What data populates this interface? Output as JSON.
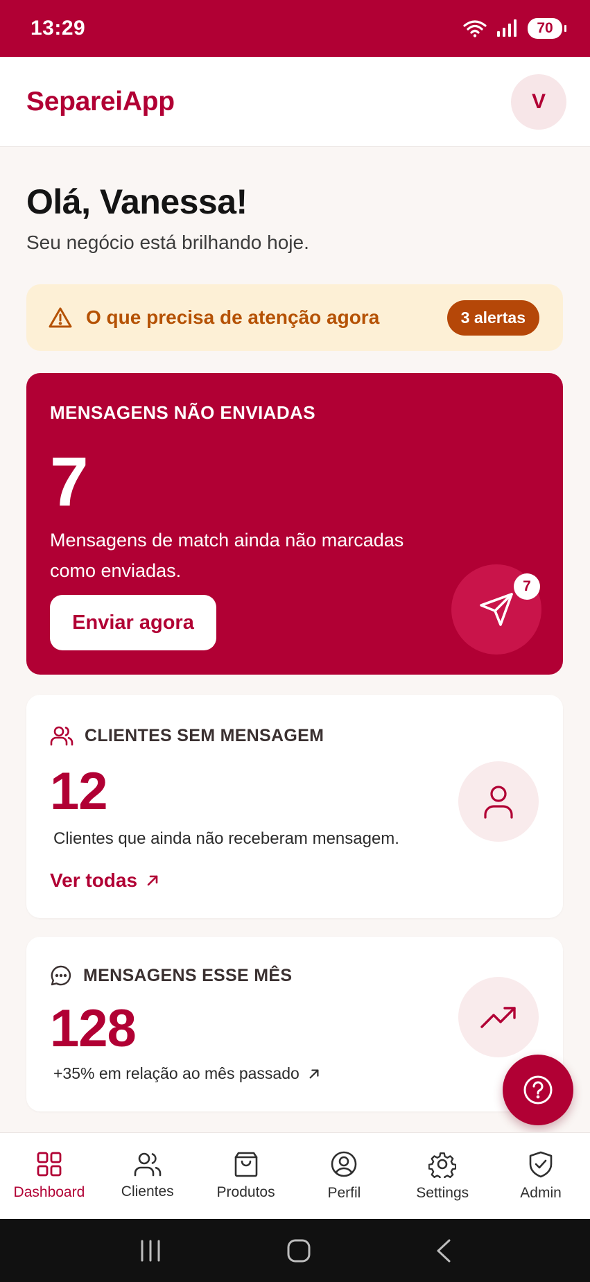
{
  "status_bar": {
    "time": "13:29",
    "battery": "70"
  },
  "header": {
    "brand": "SepareiApp",
    "avatar_initial": "V"
  },
  "greeting": {
    "title": "Olá, Vanessa!",
    "subtitle": "Seu negócio está brilhando hoje."
  },
  "alert": {
    "text": "O que precisa de atenção agora",
    "count_label": "3 alertas"
  },
  "unsent": {
    "kicker": "MENSAGENS NÃO ENVIADAS",
    "value": "7",
    "description": "Mensagens de match ainda não marcadas como enviadas.",
    "button": "Enviar agora",
    "badge": "7"
  },
  "clients_card": {
    "label": "CLIENTES SEM MENSAGEM",
    "value": "12",
    "description": "Clientes que ainda não receberam mensagem.",
    "link": "Ver todas"
  },
  "messages_card": {
    "label": "MENSAGENS ESSE MÊS",
    "value": "128",
    "trend": "+35% em relação ao mês passado"
  },
  "nav": {
    "items": [
      {
        "label": "Dashboard",
        "icon": "grid-icon"
      },
      {
        "label": "Clientes",
        "icon": "users-icon"
      },
      {
        "label": "Produtos",
        "icon": "bag-icon"
      },
      {
        "label": "Perfil",
        "icon": "user-circle-icon"
      },
      {
        "label": "Settings",
        "icon": "gear-icon"
      },
      {
        "label": "Admin",
        "icon": "shield-check-icon"
      }
    ],
    "active": "Dashboard"
  },
  "colors": {
    "primary": "#b10034",
    "alert_bg": "#fdf0d6",
    "alert_text": "#b55205",
    "alert_pill": "#b54708",
    "page_bg": "#faf6f4"
  }
}
